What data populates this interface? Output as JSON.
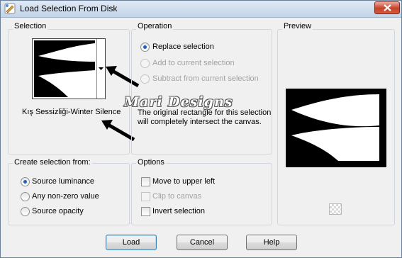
{
  "window": {
    "title": "Load Selection From Disk"
  },
  "selection": {
    "group_label": "Selection",
    "name": "Kış Sessizliği-Winter Silence"
  },
  "operation": {
    "group_label": "Operation",
    "options": [
      {
        "label": "Replace selection",
        "checked": true,
        "enabled": true
      },
      {
        "label": "Add to current selection",
        "checked": false,
        "enabled": false
      },
      {
        "label": "Subtract from current selection",
        "checked": false,
        "enabled": false
      }
    ],
    "description_line1": "The original rectangle for this selection",
    "description_line2": "will completely intersect the canvas."
  },
  "preview": {
    "group_label": "Preview"
  },
  "create_from": {
    "group_label": "Create selection from:",
    "options": [
      {
        "label": "Source luminance",
        "checked": true
      },
      {
        "label": "Any non-zero value",
        "checked": false
      },
      {
        "label": "Source opacity",
        "checked": false
      }
    ]
  },
  "options": {
    "group_label": "Options",
    "items": [
      {
        "label": "Move to upper left",
        "checked": false,
        "enabled": true
      },
      {
        "label": "Clip to canvas",
        "checked": false,
        "enabled": false
      },
      {
        "label": "Invert selection",
        "checked": false,
        "enabled": true
      }
    ]
  },
  "buttons": {
    "load": "Load",
    "cancel": "Cancel",
    "help": "Help"
  },
  "watermark": "Mari Designs",
  "colors": {
    "accent": "#1f5fbf",
    "close": "#c7412a"
  }
}
